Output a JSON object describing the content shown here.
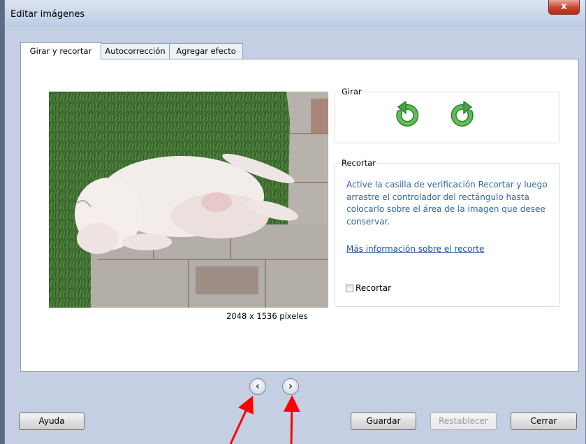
{
  "window": {
    "title": "Editar imágenes",
    "close_label": "x"
  },
  "tabs": [
    {
      "label": "Girar y recortar",
      "active": true
    },
    {
      "label": "Autocorrección",
      "active": false
    },
    {
      "label": "Agregar efecto",
      "active": false
    }
  ],
  "image": {
    "size_label": "2048 x 1536 píxeles"
  },
  "rotate": {
    "label": "Girar",
    "left_icon": "rotate-left-icon",
    "right_icon": "rotate-right-icon"
  },
  "crop": {
    "label": "Recortar",
    "help_text": "Active la casilla de verificación Recortar y luego arrastre el controlador del rectángulo hasta colocarlo sobre el área de la imagen que desee conservar.",
    "more_info_link": "Más información sobre el recorte",
    "checkbox_label": "Recortar",
    "checkbox_checked": false
  },
  "navigation": {
    "prev_glyph": "‹",
    "next_glyph": "›"
  },
  "buttons": {
    "help": "Ayuda",
    "save": "Guardar",
    "reset": "Restablecer",
    "close": "Cerrar"
  },
  "colors": {
    "window_bg": "#c4cfe3",
    "help_text": "#2f6aa8",
    "rotate_icon": "#4aa34a",
    "close_button": "#c7432e",
    "annotation_arrow": "#ff0000"
  }
}
